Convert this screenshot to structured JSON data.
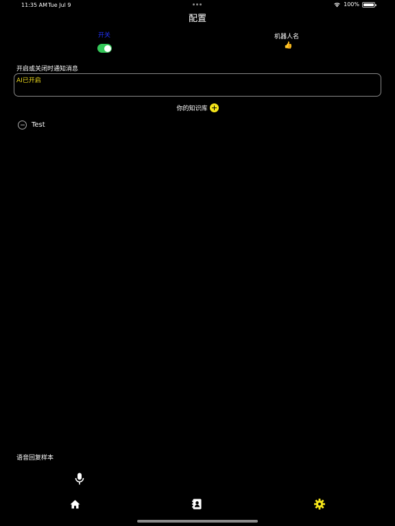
{
  "status_bar": {
    "time": "11:35 AM",
    "date": "Tue Jul 9",
    "battery": "100%",
    "icons": [
      "wifi-icon",
      "battery-icon"
    ]
  },
  "header": {
    "title": "配置"
  },
  "switch": {
    "label": "开关",
    "enabled": true,
    "on_color": "#34c759"
  },
  "robot": {
    "label": "机器人名",
    "value_icon": "👍"
  },
  "notification": {
    "label": "开启或关闭时通知消息",
    "value": "AI已开启",
    "value_color": "#f0dc1e"
  },
  "knowledge_base": {
    "label": "你的知识库",
    "add_icon": "add-circle-icon",
    "items": [
      {
        "label": "Test",
        "icon": "remove-circle-icon"
      }
    ]
  },
  "voice": {
    "label": "语音回复样本",
    "icon": "microphone-icon"
  },
  "tab_bar": {
    "tabs": [
      {
        "icon": "home-icon",
        "active": false
      },
      {
        "icon": "contacts-icon",
        "active": false
      },
      {
        "icon": "gear-icon",
        "active": true
      }
    ],
    "active_color": "#f5e51a"
  }
}
